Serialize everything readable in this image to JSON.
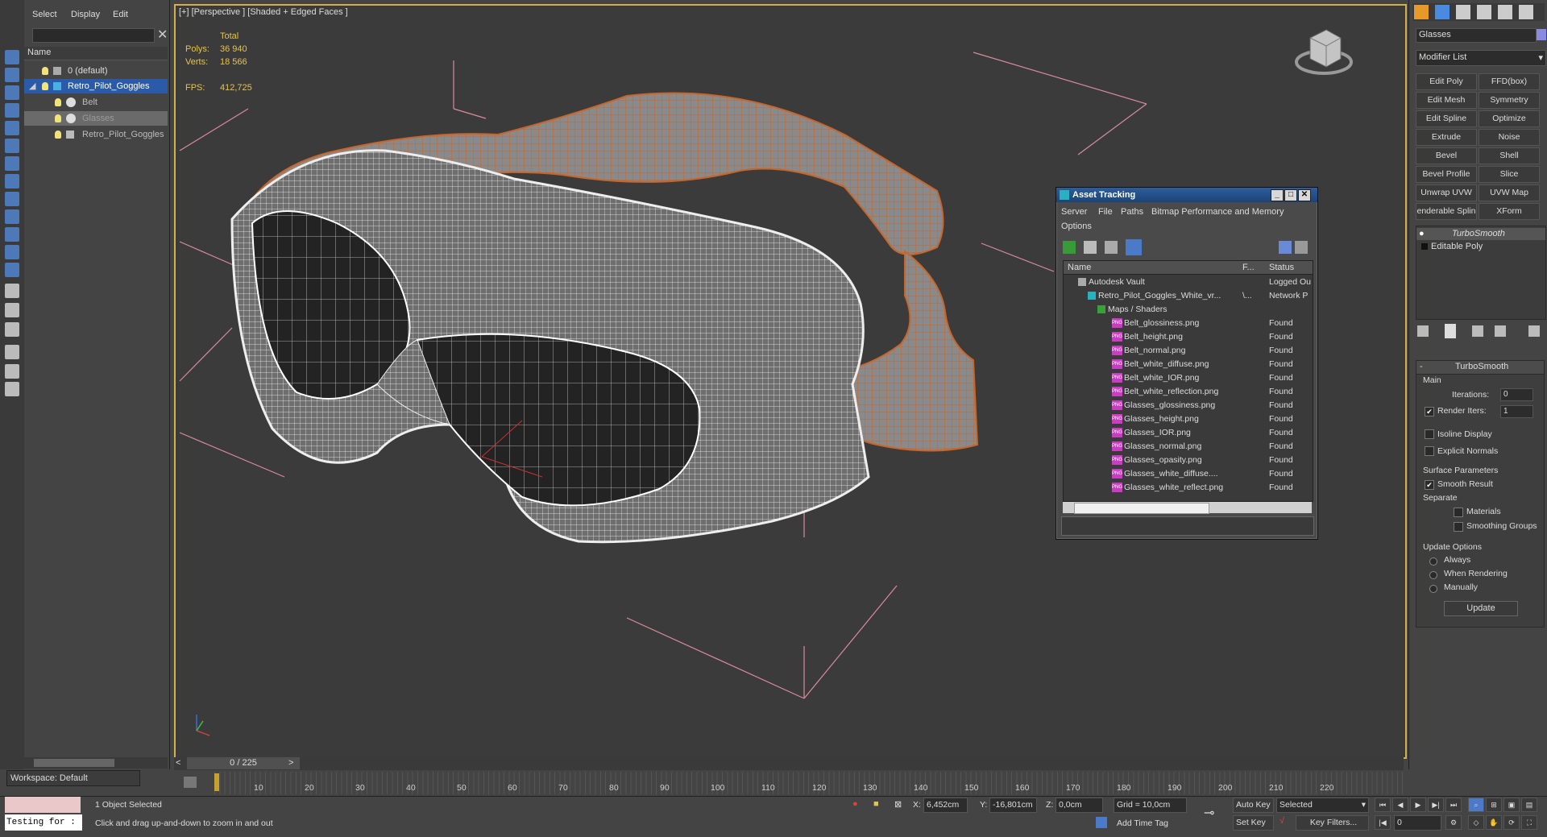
{
  "menu": {
    "select": "Select",
    "display": "Display",
    "edit": "Edit"
  },
  "scene_explorer": {
    "column_name": "Name",
    "items": [
      {
        "label": "0 (default)"
      },
      {
        "label": "Retro_Pilot_Goggles"
      },
      {
        "label": "Belt"
      },
      {
        "label": "Glasses"
      },
      {
        "label": "Retro_Pilot_Goggles"
      }
    ],
    "workspace": "Workspace: Default"
  },
  "viewport": {
    "label": "[+] [Perspective ] [Shaded + Edged Faces ]",
    "stats": {
      "total_label": "Total",
      "polys_label": "Polys:",
      "polys_value": "36 940",
      "verts_label": "Verts:",
      "verts_value": "18 566",
      "fps_label": "FPS:",
      "fps_value": "412,725"
    }
  },
  "asset_tracking": {
    "title": "Asset Tracking",
    "menu": [
      "Server",
      "File",
      "Paths",
      "Bitmap Performance and Memory",
      "Options"
    ],
    "columns": {
      "name": "Name",
      "f": "F...",
      "status": "Status"
    },
    "rows": [
      {
        "name": "Autodesk Vault",
        "f": "",
        "status": "Logged Ou"
      },
      {
        "name": "Retro_Pilot_Goggles_White_vr...",
        "f": "\\...",
        "status": "Network P"
      },
      {
        "name": "Maps / Shaders",
        "f": "",
        "status": ""
      },
      {
        "name": "Belt_glossiness.png",
        "f": "",
        "status": "Found"
      },
      {
        "name": "Belt_height.png",
        "f": "",
        "status": "Found"
      },
      {
        "name": "Belt_normal.png",
        "f": "",
        "status": "Found"
      },
      {
        "name": "Belt_white_diffuse.png",
        "f": "",
        "status": "Found"
      },
      {
        "name": "Belt_white_IOR.png",
        "f": "",
        "status": "Found"
      },
      {
        "name": "Belt_white_reflection.png",
        "f": "",
        "status": "Found"
      },
      {
        "name": "Glasses_glossiness.png",
        "f": "",
        "status": "Found"
      },
      {
        "name": "Glasses_height.png",
        "f": "",
        "status": "Found"
      },
      {
        "name": "Glasses_IOR.png",
        "f": "",
        "status": "Found"
      },
      {
        "name": "Glasses_normal.png",
        "f": "",
        "status": "Found"
      },
      {
        "name": "Glasses_opasity.png",
        "f": "",
        "status": "Found"
      },
      {
        "name": "Glasses_white_diffuse....",
        "f": "",
        "status": "Found"
      },
      {
        "name": "Glasses_white_reflect.png",
        "f": "",
        "status": "Found"
      }
    ]
  },
  "command_panel": {
    "object_name": "Glasses",
    "modifier_list": "Modifier List",
    "buttons": [
      "Edit Poly",
      "FFD(box)",
      "Edit Mesh",
      "Symmetry",
      "Edit Spline",
      "Optimize",
      "Extrude",
      "Noise",
      "Bevel",
      "Shell",
      "Bevel Profile",
      "Slice",
      "Unwrap UVW",
      "UVW Map",
      "enderable Splin",
      "XForm"
    ],
    "stack": [
      "TurboSmooth",
      "Editable Poly"
    ],
    "turbosmooth": {
      "title": "TurboSmooth",
      "main": "Main",
      "iterations_label": "Iterations:",
      "iterations_value": "0",
      "render_iters_label": "Render Iters:",
      "render_iters_value": "1",
      "isoline": "Isoline Display",
      "explicit": "Explicit Normals",
      "surface": "Surface Parameters",
      "smooth_result": "Smooth Result",
      "separate": "Separate",
      "materials": "Materials",
      "smoothing_groups": "Smoothing Groups",
      "update_options": "Update Options",
      "always": "Always",
      "when_rendering": "When Rendering",
      "manually": "Manually",
      "update": "Update"
    }
  },
  "timeline": {
    "frame": "0 / 225",
    "ticks": [
      "10",
      "20",
      "30",
      "40",
      "50",
      "60",
      "70",
      "80",
      "90",
      "100",
      "110",
      "120",
      "130",
      "140",
      "150",
      "160",
      "170",
      "180",
      "190",
      "200",
      "210",
      "220"
    ]
  },
  "status": {
    "selection": "1 Object Selected",
    "prompt": "Click and drag up-and-down to zoom in and out",
    "maxscript": "Testing for :",
    "x_label": "X:",
    "x_value": "6,452cm",
    "y_label": "Y:",
    "y_value": "-16,801cm",
    "z_label": "Z:",
    "z_value": "0,0cm",
    "grid": "Grid = 10,0cm",
    "add_time_tag": "Add Time Tag",
    "auto_key": "Auto Key",
    "set_key": "Set Key",
    "selected": "Selected",
    "key_filters": "Key Filters...",
    "current_frame": "0"
  },
  "colors": {
    "viewport_border": "#d4b04a",
    "belt": "#c8652a",
    "selection": "#2a5aa8"
  }
}
